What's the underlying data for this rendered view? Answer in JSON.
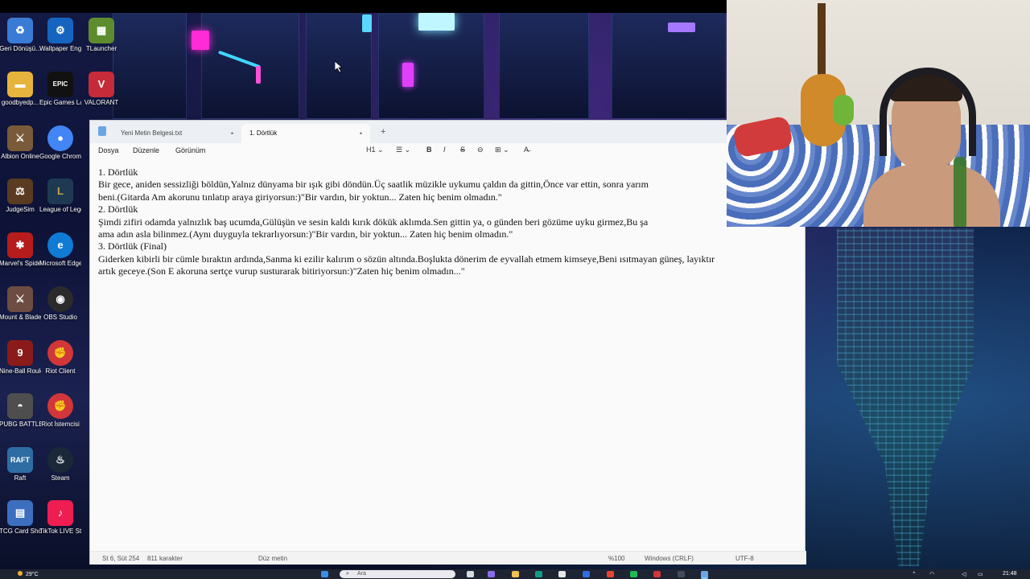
{
  "desktop": {
    "icons": [
      {
        "label": "Geri Dönüşü...",
        "color": "#3a7bd5"
      },
      {
        "label": "Wallpaper Engine",
        "color": "#1565c0"
      },
      {
        "label": "TLauncher",
        "color": "#5d8c2f"
      },
      {
        "label": "goodbyedp...",
        "color": "#e6b43c"
      },
      {
        "label": "Epic Games Launcher",
        "color": "#111111"
      },
      {
        "label": "VALORANT",
        "color": "#c62b39"
      },
      {
        "label": "Albion Online",
        "color": "#7a5a3a"
      },
      {
        "label": "Google Chrome",
        "color": "#4285f4"
      },
      {
        "label": "JudgeSim",
        "color": "#5a3b22"
      },
      {
        "label": "League of Legends",
        "color": "#1e3a52"
      },
      {
        "label": "Marvel's Spider-M...",
        "color": "#b71c1c"
      },
      {
        "label": "Microsoft Edge",
        "color": "#0f7bd4"
      },
      {
        "label": "Mount & Blade...",
        "color": "#6d4c41"
      },
      {
        "label": "OBS Studio",
        "color": "#2b2b2b"
      },
      {
        "label": "Nine-Ball Roulette",
        "color": "#8b1a1a"
      },
      {
        "label": "Riot Client",
        "color": "#d13639"
      },
      {
        "label": "PUBG BATTLEGR...",
        "color": "#4e4e4e"
      },
      {
        "label": "Riot İstemcisi",
        "color": "#d13639"
      },
      {
        "label": "Raft",
        "color": "#2e6da4"
      },
      {
        "label": "Steam",
        "color": "#1b2838"
      },
      {
        "label": "TCG Card Shop Si...",
        "color": "#3c6fbf"
      },
      {
        "label": "TikTok LIVE Studio",
        "color": "#ee1d52"
      }
    ]
  },
  "notepad": {
    "tabs": [
      {
        "label": "Yeni Metin Belgesi.txt",
        "close": "•"
      },
      {
        "label": "1. Dörtlük",
        "close": "•"
      }
    ],
    "add_tab": "+",
    "menu": {
      "file": "Dosya",
      "edit": "Düzenle",
      "view": "Görünüm"
    },
    "format_toolbar": {
      "heading": "H1 ⌄",
      "list": "☰ ⌄",
      "bold": "B",
      "italic": "I",
      "strike": "S",
      "link": "⊖",
      "table": "⊞ ⌄",
      "clear": "A̶"
    },
    "content": [
      "1. Dörtlük",
      "Bir gece, aniden sessizliği böldün,Yalnız dünyama bir ışık gibi döndün.Üç saatlik müzikle uykumu çaldın da gittin,Önce var ettin, sonra yarım",
      "beni.(Gitarda Am akorunu tınlatıp araya giriyorsun:)\"Bir vardın, bir yoktun... Zaten hiç benim olmadın.\"",
      "2. Dörtlük",
      "Şimdi zifiri odamda yalnızlık baş ucumda,Gülüşün ve sesin kaldı kırık dökük aklımda.Sen gittin ya, o günden beri gözüme uyku girmez,Bu şa",
      "ama adın asla bilinmez.(Aynı duyguyla tekrarlıyorsun:)\"Bir vardın, bir yoktun... Zaten hiç benim olmadın.\"",
      "3. Dörtlük (Final)",
      " Giderken kibirli bir cümle bıraktın ardında,Sanma ki ezilir kalırım o sözün altında.Boşlukta dönerim de eyvallah etmem kimseye,Beni ısıtmayan güneş, layıktır",
      "artık geceye.(Son E akoruna sertçe vurup susturarak bitiriyorsun:)\"Zaten hiç benim olmadın...\""
    ],
    "status": {
      "position": "St 6, Süt 254",
      "chars": "811 karakter",
      "mode": "Düz metin",
      "zoom": "%100",
      "line_ending": "Windows (CRLF)",
      "encoding": "UTF-8"
    }
  },
  "taskbar": {
    "weather": "29°C",
    "search_placeholder": "Ara",
    "clock": "21:48"
  }
}
